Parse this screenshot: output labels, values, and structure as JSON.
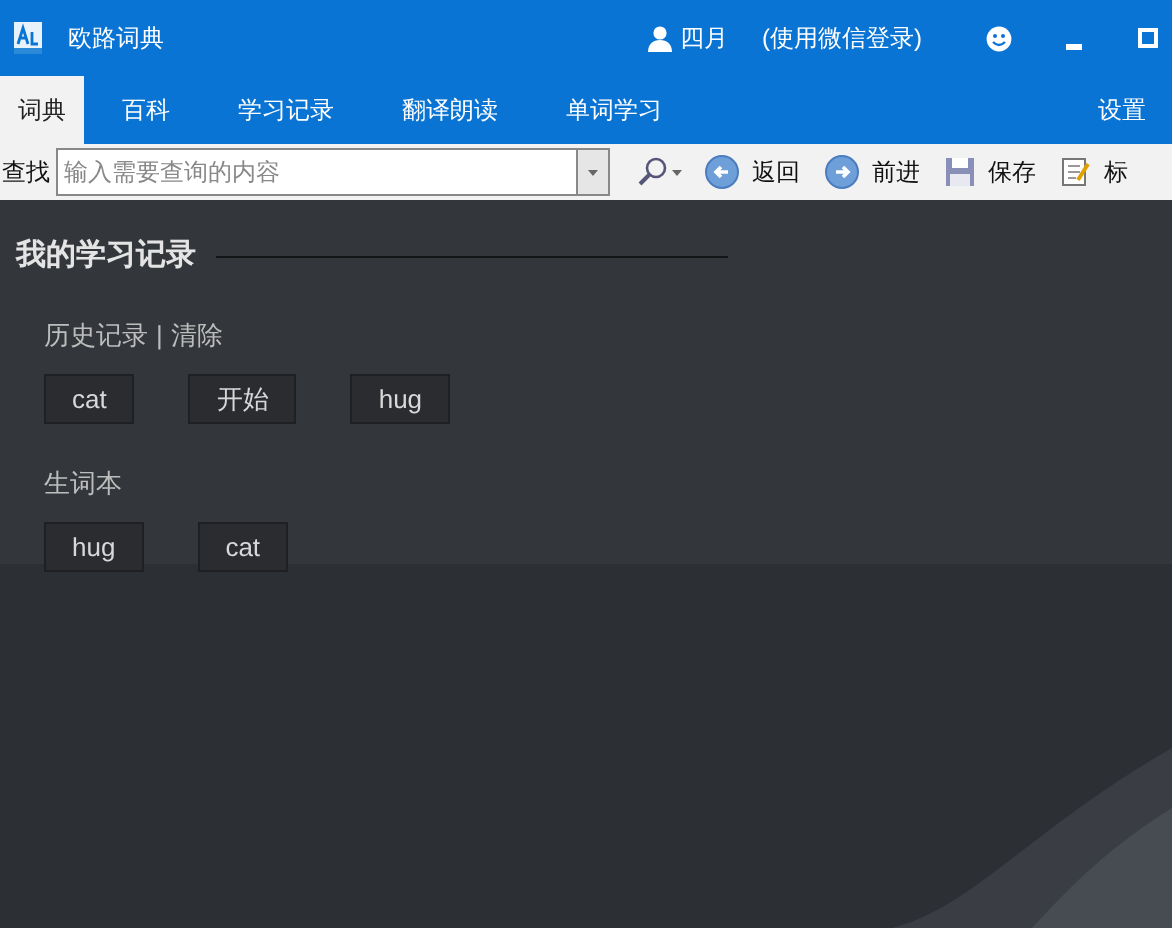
{
  "window": {
    "title": "欧路词典",
    "user": "四月",
    "login": "(使用微信登录)"
  },
  "tabs": [
    {
      "label": "词典",
      "selected": true
    },
    {
      "label": "百科",
      "selected": false
    },
    {
      "label": "学习记录",
      "selected": false
    },
    {
      "label": "翻译朗读",
      "selected": false
    },
    {
      "label": "单词学习",
      "selected": false
    }
  ],
  "settings": "设置",
  "toolbar": {
    "label": "查找",
    "search": {
      "placeholder": "输入需要查询的内容"
    },
    "buttons": [
      {
        "kind": "back",
        "label": "返回"
      },
      {
        "kind": "forward",
        "label": "前进"
      },
      {
        "kind": "save",
        "label": "保存"
      },
      {
        "kind": "note",
        "label": "标"
      }
    ]
  },
  "section_title": "我的学习记录",
  "history": {
    "title": "历史记录",
    "separator": "|",
    "clear": "清除",
    "words": [
      "cat",
      "开始",
      "hug"
    ]
  },
  "wordbook": {
    "title": "生词本",
    "words": [
      "hug",
      "cat"
    ]
  }
}
